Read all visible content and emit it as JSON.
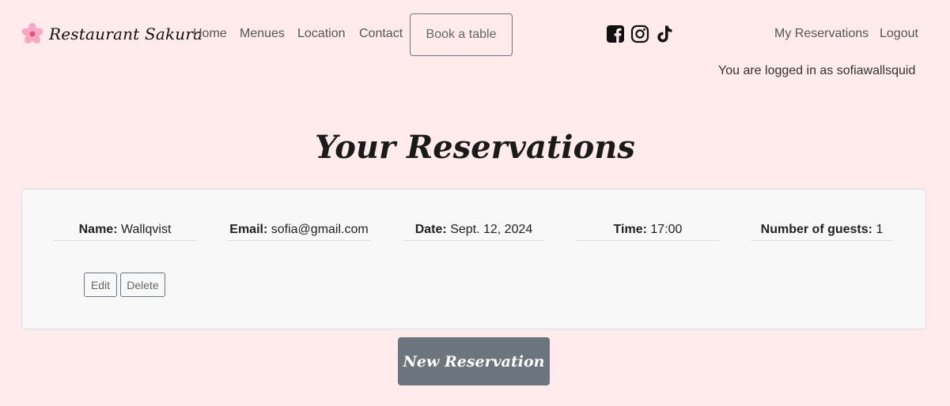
{
  "nav": {
    "brand": "Restaurant Sakura",
    "links": [
      "Home",
      "Menues",
      "Location",
      "Contact"
    ],
    "book_label": "Book a table",
    "social": [
      "facebook-square-icon",
      "instagram-icon",
      "tiktok-icon"
    ],
    "right_links": [
      "My Reservations",
      "Logout"
    ],
    "logged_in_text": "You are logged in as sofiawallsquid"
  },
  "page": {
    "title": "Your Reservations"
  },
  "reservation": {
    "name_label": "Name:",
    "name": "Wallqvist",
    "email_label": "Email:",
    "email": "sofia@gmail.com",
    "date_label": "Date:",
    "date": "Sept. 12, 2024",
    "time_label": "Time:",
    "time": "17:00",
    "guests_label": "Number of guests:",
    "guests": "1",
    "edit_label": "Edit",
    "delete_label": "Delete"
  },
  "actions": {
    "new_reservation": "New Reservation"
  },
  "colors": {
    "background": "#ffebeb",
    "card": "#f8f8f8",
    "button": "#6c757d"
  }
}
